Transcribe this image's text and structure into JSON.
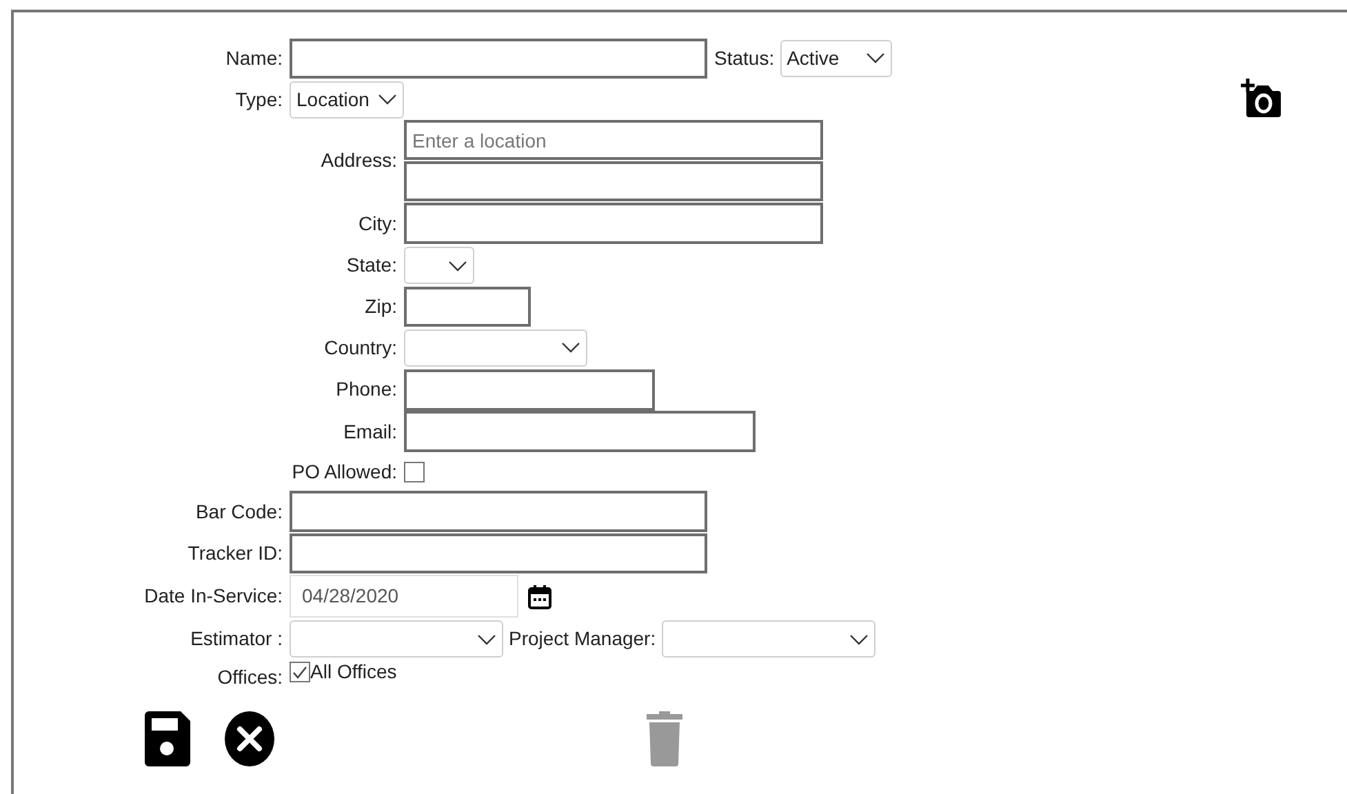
{
  "form": {
    "name": {
      "label": "Name:"
    },
    "status": {
      "label": "Status:",
      "value": "Active"
    },
    "type": {
      "label": "Type:",
      "value": "Location"
    },
    "address": {
      "label": "Address:",
      "placeholder": "Enter a location"
    },
    "city": {
      "label": "City:"
    },
    "state": {
      "label": "State:"
    },
    "zip": {
      "label": "Zip:"
    },
    "country": {
      "label": "Country:"
    },
    "phone": {
      "label": "Phone:"
    },
    "email": {
      "label": "Email:"
    },
    "po_allowed": {
      "label": "PO Allowed:",
      "checked": false
    },
    "bar_code": {
      "label": "Bar Code:"
    },
    "tracker_id": {
      "label": "Tracker ID:"
    },
    "date_in_service": {
      "label": "Date In-Service:",
      "value": "04/28/2020"
    },
    "estimator": {
      "label": "Estimator :"
    },
    "project_manager": {
      "label": "Project Manager:"
    },
    "offices": {
      "label": "Offices:",
      "option": "All Offices",
      "checked": true
    }
  }
}
